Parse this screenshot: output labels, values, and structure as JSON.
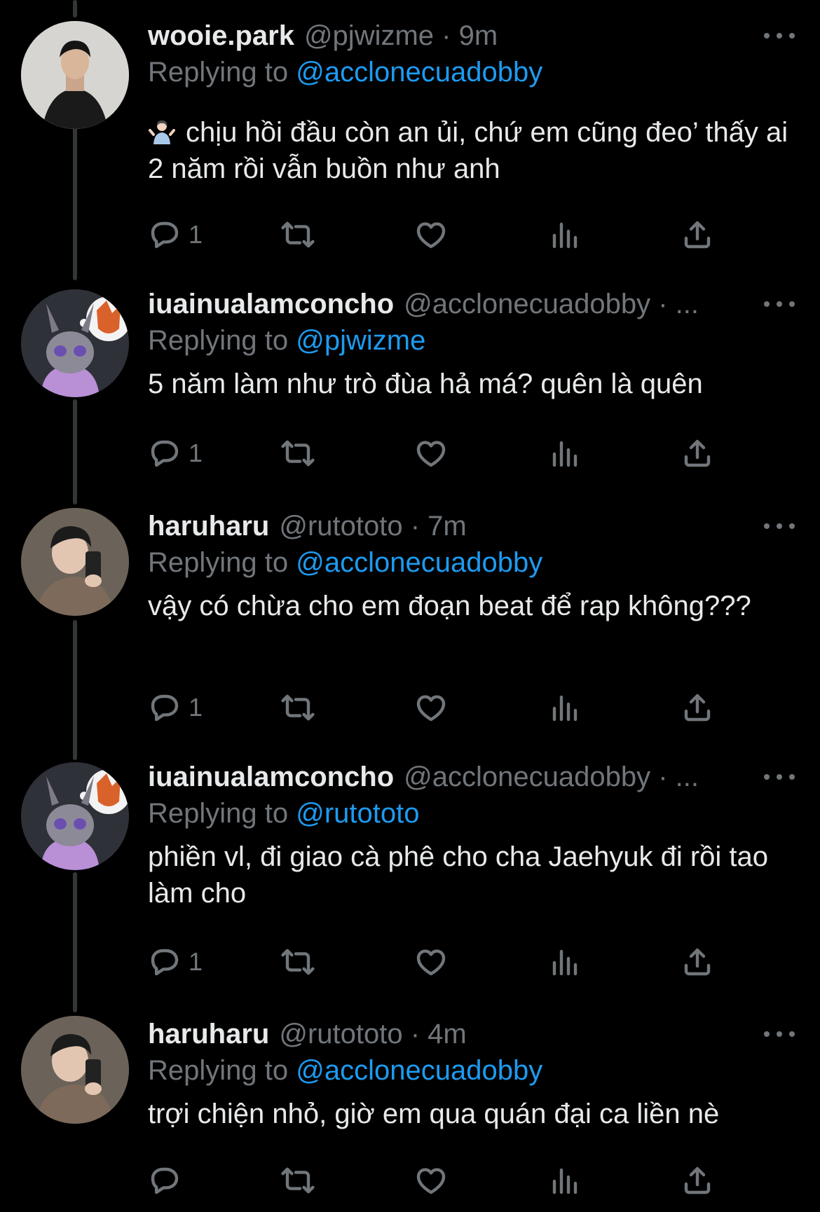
{
  "tweets": [
    {
      "name": "wooie.park",
      "meta": "@pjwizme · 9m",
      "replying_prefix": "Replying to ",
      "replying_handle": "@acclonecuadobby",
      "text": "chịu hồi đầu còn an ủi, chứ em cũng đeo’ thấy ai 2 năm rồi vẫn buồn như anh",
      "reply_count": "1",
      "leading_emoji": "person-shrugging-emoji"
    },
    {
      "name": "iuainualamconcho",
      "meta": "@acclonecuadobby · ...",
      "replying_prefix": "Replying to ",
      "replying_handle": "@pjwizme",
      "text": "5 năm làm như trò đùa hả má? quên là quên",
      "reply_count": "1"
    },
    {
      "name": "haruharu",
      "meta": "@rutototo · 7m",
      "replying_prefix": "Replying to ",
      "replying_handle": "@acclonecuadobby",
      "text": "vậy có chừa cho em đoạn beat để rap không???",
      "reply_count": "1"
    },
    {
      "name": "iuainualamconcho",
      "meta": "@acclonecuadobby · ...",
      "replying_prefix": "Replying to ",
      "replying_handle": "@rutototo",
      "text": "phiền vl, đi giao cà phê cho cha Jaehyuk đi rồi tao làm cho",
      "reply_count": "1"
    },
    {
      "name": "haruharu",
      "meta": "@rutototo · 4m",
      "replying_prefix": "Replying to ",
      "replying_handle": "@acclonecuadobby",
      "text": "trợi chiện nhỏ, giờ em qua quán đại ca liền nè",
      "reply_count": ""
    }
  ],
  "icons": {
    "reply": "reply-icon",
    "retweet": "retweet-icon",
    "like": "like-icon",
    "views": "views-icon",
    "share": "share-icon",
    "more": "more-icon"
  },
  "colors": {
    "background": "#000000",
    "primary_text": "#e7e9ea",
    "secondary_text": "#71767b",
    "link": "#1d9bf0",
    "thread_line": "#333639"
  }
}
